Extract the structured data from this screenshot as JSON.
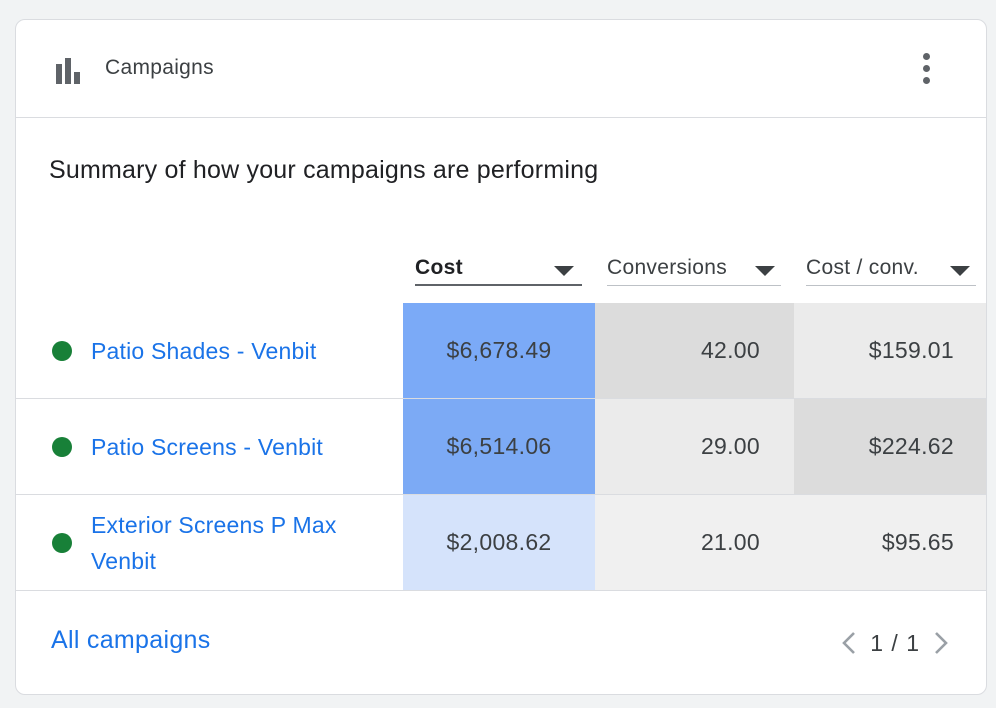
{
  "header": {
    "title": "Campaigns",
    "icon": "bar-chart-icon",
    "more_icon": "more-vert-icon"
  },
  "subtitle": "Summary of how your campaigns are performing",
  "columns": [
    {
      "label": "Cost",
      "sorted": true
    },
    {
      "label": "Conversions",
      "sorted": false
    },
    {
      "label": "Cost / conv.",
      "sorted": false
    }
  ],
  "rows": [
    {
      "status": "enabled",
      "name": "Patio Shades - Venbit",
      "cost": "$6,678.49",
      "conversions": "42.00",
      "cost_per_conv": "$159.01",
      "colors": {
        "cost": "#7baaf7",
        "conversions": "#dcdcdc",
        "cost_per_conv": "#ebebeb"
      }
    },
    {
      "status": "enabled",
      "name": "Patio Screens - Venbit",
      "cost": "$6,514.06",
      "conversions": "29.00",
      "cost_per_conv": "$224.62",
      "colors": {
        "cost": "#7caaf5",
        "conversions": "#ebebeb",
        "cost_per_conv": "#dcdcdc"
      }
    },
    {
      "status": "enabled",
      "name": "Exterior Screens P Max Venbit",
      "cost": "$2,008.62",
      "conversions": "21.00",
      "cost_per_conv": "$95.65",
      "colors": {
        "cost": "#d5e3fb",
        "conversions": "#f0f0f0",
        "cost_per_conv": "#f0f0f0"
      }
    }
  ],
  "footer": {
    "link_label": "All campaigns",
    "page_text": "1 / 1",
    "prev_icon": "chevron-left-icon",
    "next_icon": "chevron-right-icon"
  },
  "colors": {
    "accent": "#1a73e8",
    "status_green": "#188038"
  }
}
